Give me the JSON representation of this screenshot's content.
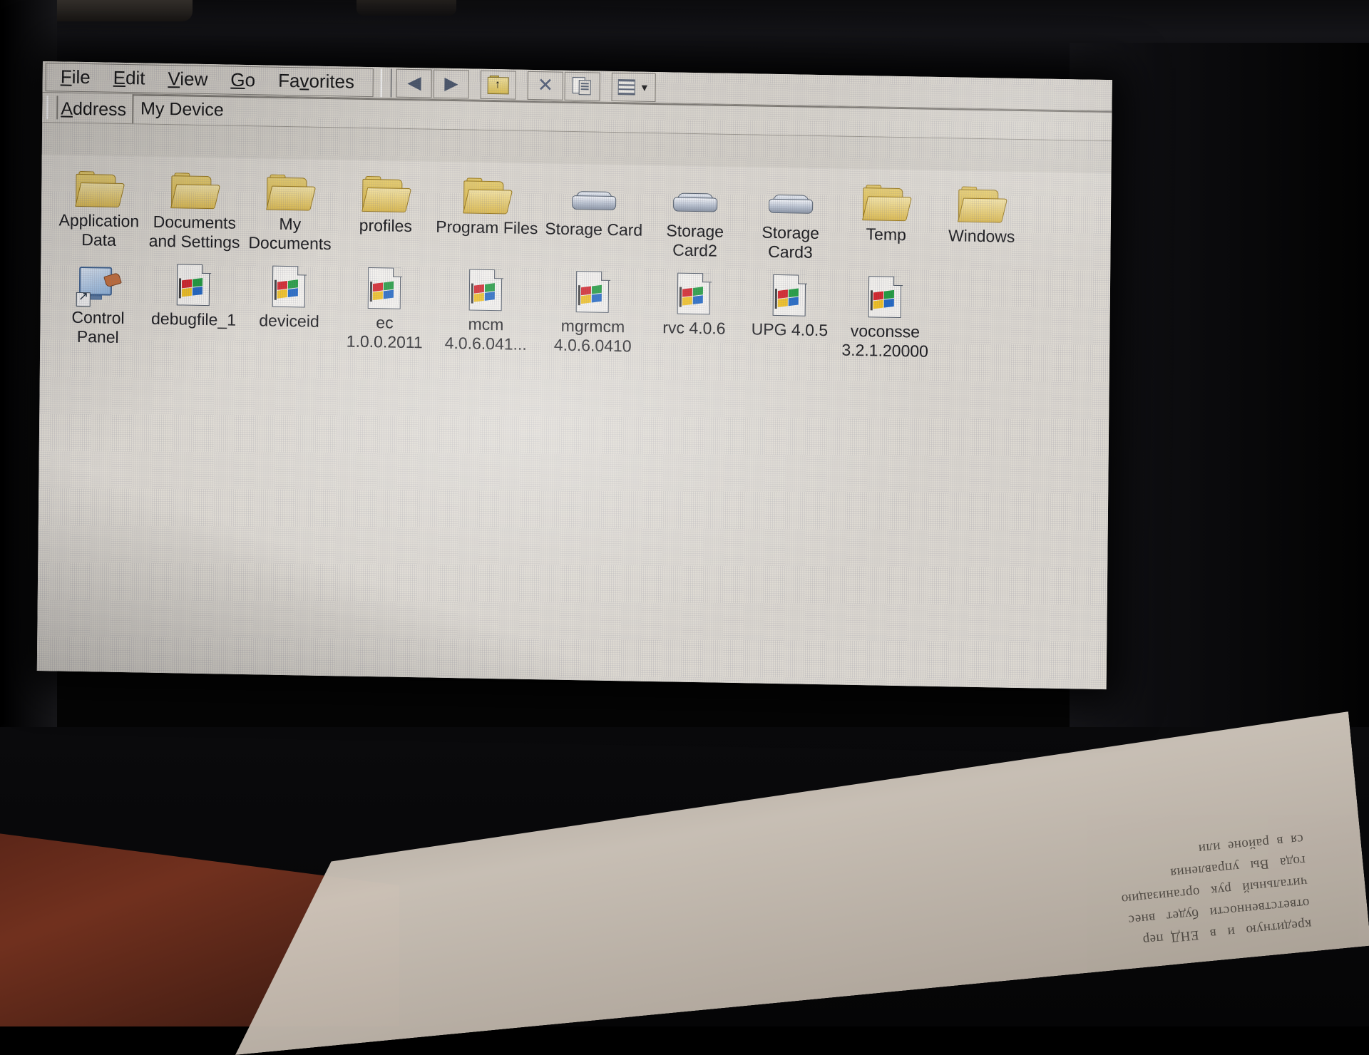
{
  "window": {
    "title": "My Device",
    "menu": [
      {
        "label": "File",
        "accel": "F"
      },
      {
        "label": "Edit",
        "accel": "E"
      },
      {
        "label": "View",
        "accel": "V"
      },
      {
        "label": "Go",
        "accel": "G"
      },
      {
        "label": "Favorites",
        "accel": "v"
      }
    ],
    "toolbar": [
      {
        "name": "back-button",
        "glyph": "◄"
      },
      {
        "name": "forward-button",
        "glyph": "►"
      },
      {
        "name": "up-one-level-button",
        "glyph": "↑"
      },
      {
        "name": "delete-button",
        "glyph": "✕"
      },
      {
        "name": "properties-button",
        "glyph": "▤"
      },
      {
        "name": "views-button",
        "glyph": "▦"
      }
    ],
    "address": {
      "label": "Address",
      "accel": "d",
      "value": "My Device"
    }
  },
  "items_row1": [
    {
      "name": "Application\nData",
      "icon": "folder"
    },
    {
      "name": "Documents\nand Settings",
      "icon": "folder"
    },
    {
      "name": "My\nDocuments",
      "icon": "folder"
    },
    {
      "name": "profiles",
      "icon": "folder"
    },
    {
      "name": "Program Files",
      "icon": "folder"
    },
    {
      "name": "Storage Card",
      "icon": "removable-disk"
    },
    {
      "name": "Storage\nCard2",
      "icon": "removable-disk"
    },
    {
      "name": "Storage\nCard3",
      "icon": "removable-disk"
    },
    {
      "name": "Temp",
      "icon": "folder"
    },
    {
      "name": "Windows",
      "icon": "folder"
    }
  ],
  "items_row2": [
    {
      "name": "Control\nPanel",
      "icon": "control-panel-shortcut"
    },
    {
      "name": "debugfile_1",
      "icon": "windows-file"
    },
    {
      "name": "deviceid",
      "icon": "windows-file"
    },
    {
      "name": "ec\n1.0.0.2011",
      "icon": "windows-file"
    },
    {
      "name": "mcm\n4.0.6.041...",
      "icon": "windows-file"
    },
    {
      "name": "mgrmcm\n4.0.6.0410",
      "icon": "windows-file"
    },
    {
      "name": "rvc 4.0.6",
      "icon": "windows-file"
    },
    {
      "name": "UPG 4.0.5",
      "icon": "windows-file"
    },
    {
      "name": "voconsse\n3.2.1.20000",
      "icon": "windows-file"
    }
  ],
  "photo": {
    "paper_text": "кредитную   и   в   ЕНД  пер\nответственности   будет   внес\nчитальный   рук   организацию\nгода   Вы   управления\nся  в  районе  или"
  },
  "colors": {
    "chrome": "#d4d0c8",
    "pane": "#dedad2",
    "folder": "#d9b545",
    "text": "#17171a"
  }
}
